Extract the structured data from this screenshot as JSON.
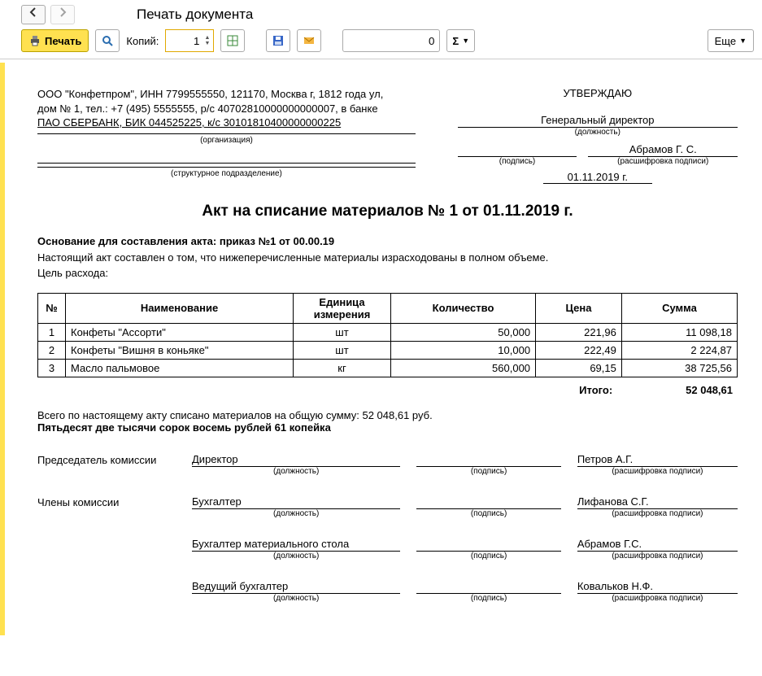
{
  "window": {
    "title": "Печать документа"
  },
  "toolbar": {
    "print_label": "Печать",
    "copies_label": "Копий:",
    "copies_value": "1",
    "page_value": "0",
    "more_label": "Еще"
  },
  "org": {
    "text_line1": "ООО \"Конфетпром\", ИНН 7799555550, 121170, Москва г, 1812 года ул,",
    "text_line2": "дом № 1, тел.: +7 (495) 5555555, р/с 40702810000000000007, в банке",
    "text_line3": "ПАО СБЕРБАНК, БИК 044525225, к/с 30101810400000000225",
    "org_hint": "(организация)",
    "dept_hint": "(структурное подразделение)"
  },
  "approve": {
    "title": "УТВЕРЖДАЮ",
    "position": "Генеральный директор",
    "position_hint": "(должность)",
    "sign_hint": "(подпись)",
    "decr_hint": "(расшифровка подписи)",
    "name": "Абрамов Г. С.",
    "date": "01.11.2019 г."
  },
  "doc_title": "Акт на списание материалов № 1 от 01.11.2019 г.",
  "basis": {
    "line1_b": "Основание для составления акта: приказ №1 от 00.00.19",
    "line2": "Настоящий акт составлен о том, что нижеперечисленные материалы израсходованы в полном объеме.",
    "line3": "Цель расхода:"
  },
  "table": {
    "headers": {
      "n": "№",
      "name": "Наименование",
      "unit": "Единица измерения",
      "qty": "Количество",
      "price": "Цена",
      "sum": "Сумма"
    },
    "rows": [
      {
        "n": "1",
        "name": "Конфеты \"Ассорти\"",
        "unit": "шт",
        "qty": "50,000",
        "price": "221,96",
        "sum": "11 098,18"
      },
      {
        "n": "2",
        "name": "Конфеты \"Вишня в коньяке\"",
        "unit": "шт",
        "qty": "10,000",
        "price": "222,49",
        "sum": "2 224,87"
      },
      {
        "n": "3",
        "name": "Масло пальмовое",
        "unit": "кг",
        "qty": "560,000",
        "price": "69,15",
        "sum": "38 725,56"
      }
    ],
    "total_label": "Итого:",
    "total_value": "52 048,61"
  },
  "summary": {
    "line1": "Всего по настоящему акту списано материалов на общую сумму: 52 048,61 руб.",
    "line2": "Пятьдесят две тысячи сорок восемь рублей 61 копейка"
  },
  "sign": {
    "role1": "Председатель комиссии",
    "role2": "Члены комиссии",
    "pos_hint": "(должность)",
    "sign_hint": "(подпись)",
    "decr_hint": "(расшифровка подписи)",
    "rows": [
      {
        "pos": "Директор",
        "name": "Петров А.Г."
      },
      {
        "pos": "Бухгалтер",
        "name": "Лифанова С.Г."
      },
      {
        "pos": "Бухгалтер материального стола",
        "name": "Абрамов Г.С."
      },
      {
        "pos": "Ведущий бухгалтер",
        "name": "Ковальков Н.Ф."
      }
    ]
  }
}
